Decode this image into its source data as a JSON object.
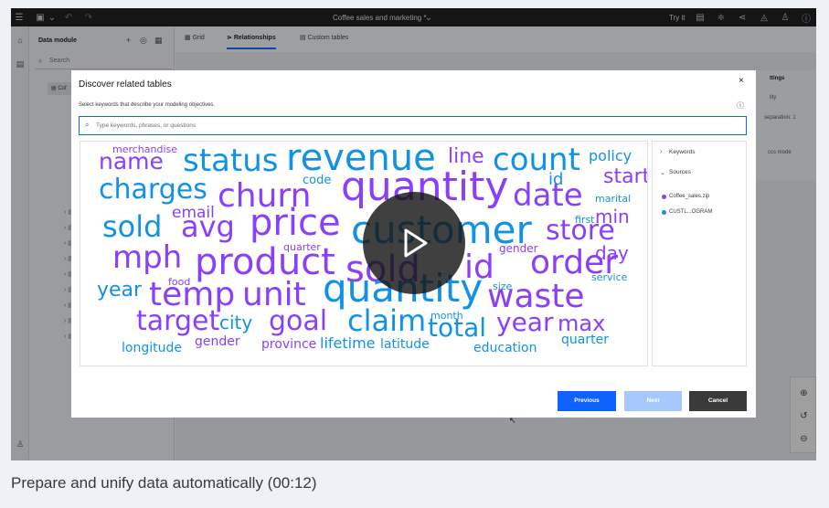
{
  "app": {
    "document_title": "Coffee sales and marketing *",
    "try_it": "Try it"
  },
  "side_panel": {
    "title": "Data module",
    "search_placeholder": "Search",
    "root_item": "Cof"
  },
  "tabs": [
    {
      "label": "Grid",
      "active": false
    },
    {
      "label": "Relationships",
      "active": true
    },
    {
      "label": "Custom tables",
      "active": false
    }
  ],
  "right_props": {
    "heading": "ttings",
    "line1": "lity",
    "line2": "separation: 1",
    "line3": "ccs mode"
  },
  "modal": {
    "title": "Discover related tables",
    "subtitle": "Select keywords that describe your modeling objectives.",
    "search_placeholder": "Type keywords, phrases, or questions",
    "filters": {
      "keywords_label": "Keywords",
      "sources_label": "Sources",
      "sources": [
        {
          "name": "Coffee_sales.zip",
          "color": "#8a3ffc"
        },
        {
          "name": "CUSTL...OGRAM",
          "color": "#1192e8"
        }
      ]
    },
    "buttons": {
      "previous": "Previous",
      "next": "Next",
      "cancel": "Cancel"
    }
  },
  "word_cloud": [
    {
      "text": "merchandise",
      "color": "#8a3ffc",
      "size": 11
    },
    {
      "text": "name",
      "color": "#8a3ffc",
      "size": 25
    },
    {
      "text": "status",
      "color": "#1192e8",
      "size": 34
    },
    {
      "text": "revenue",
      "color": "#1192e8",
      "size": 40
    },
    {
      "text": "line",
      "color": "#8a3ffc",
      "size": 22
    },
    {
      "text": "count",
      "color": "#1192e8",
      "size": 34
    },
    {
      "text": "policy",
      "color": "#1192e8",
      "size": 16
    },
    {
      "text": "start",
      "color": "#8a3ffc",
      "size": 22
    },
    {
      "text": "id",
      "color": "#1192e8",
      "size": 18
    },
    {
      "text": "charges",
      "color": "#1192e8",
      "size": 30
    },
    {
      "text": "code",
      "color": "#1192e8",
      "size": 13
    },
    {
      "text": "churn",
      "color": "#8a3ffc",
      "size": 36
    },
    {
      "text": "quantity",
      "color": "#8a3ffc",
      "size": 44
    },
    {
      "text": "date",
      "color": "#8a3ffc",
      "size": 34
    },
    {
      "text": "marital",
      "color": "#1192e8",
      "size": 11
    },
    {
      "text": "email",
      "color": "#8a3ffc",
      "size": 17
    },
    {
      "text": "first",
      "color": "#1192e8",
      "size": 11
    },
    {
      "text": "min",
      "color": "#8a3ffc",
      "size": 20
    },
    {
      "text": "sold",
      "color": "#1192e8",
      "size": 32
    },
    {
      "text": "avg",
      "color": "#8a3ffc",
      "size": 32
    },
    {
      "text": "price",
      "color": "#8a3ffc",
      "size": 40
    },
    {
      "text": "customer",
      "color": "#1192e8",
      "size": 42
    },
    {
      "text": "store",
      "color": "#8a3ffc",
      "size": 30
    },
    {
      "text": "quarter",
      "color": "#8a3ffc",
      "size": 11
    },
    {
      "text": "gender",
      "color": "#8a3ffc",
      "size": 12
    },
    {
      "text": "day",
      "color": "#8a3ffc",
      "size": 20
    },
    {
      "text": "mph",
      "color": "#8a3ffc",
      "size": 34
    },
    {
      "text": "product",
      "color": "#8a3ffc",
      "size": 40
    },
    {
      "text": "sold",
      "color": "#8a3ffc",
      "size": 40
    },
    {
      "text": "id",
      "color": "#8a3ffc",
      "size": 36
    },
    {
      "text": "order",
      "color": "#8a3ffc",
      "size": 36
    },
    {
      "text": "food",
      "color": "#8a3ffc",
      "size": 11
    },
    {
      "text": "service",
      "color": "#1192e8",
      "size": 11
    },
    {
      "text": "year",
      "color": "#1192e8",
      "size": 22
    },
    {
      "text": "temp",
      "color": "#8a3ffc",
      "size": 36
    },
    {
      "text": "unit",
      "color": "#8a3ffc",
      "size": 36
    },
    {
      "text": "quantity",
      "color": "#1192e8",
      "size": 42
    },
    {
      "text": "size",
      "color": "#1192e8",
      "size": 11
    },
    {
      "text": "waste",
      "color": "#8a3ffc",
      "size": 36
    },
    {
      "text": "target",
      "color": "#8a3ffc",
      "size": 30
    },
    {
      "text": "city",
      "color": "#1192e8",
      "size": 20
    },
    {
      "text": "goal",
      "color": "#8a3ffc",
      "size": 30
    },
    {
      "text": "claim",
      "color": "#1192e8",
      "size": 32
    },
    {
      "text": "month",
      "color": "#1192e8",
      "size": 11
    },
    {
      "text": "total",
      "color": "#1192e8",
      "size": 28
    },
    {
      "text": "year",
      "color": "#8a3ffc",
      "size": 28
    },
    {
      "text": "max",
      "color": "#8a3ffc",
      "size": 24
    },
    {
      "text": "longitude",
      "color": "#1192e8",
      "size": 14
    },
    {
      "text": "gender",
      "color": "#8a3ffc",
      "size": 14
    },
    {
      "text": "province",
      "color": "#8a3ffc",
      "size": 14
    },
    {
      "text": "lifetime",
      "color": "#1192e8",
      "size": 16
    },
    {
      "text": "latitude",
      "color": "#1192e8",
      "size": 14
    },
    {
      "text": "education",
      "color": "#1192e8",
      "size": 14
    },
    {
      "text": "quarter",
      "color": "#1192e8",
      "size": 14
    }
  ],
  "caption": "Prepare and unify data automatically (00:12)"
}
